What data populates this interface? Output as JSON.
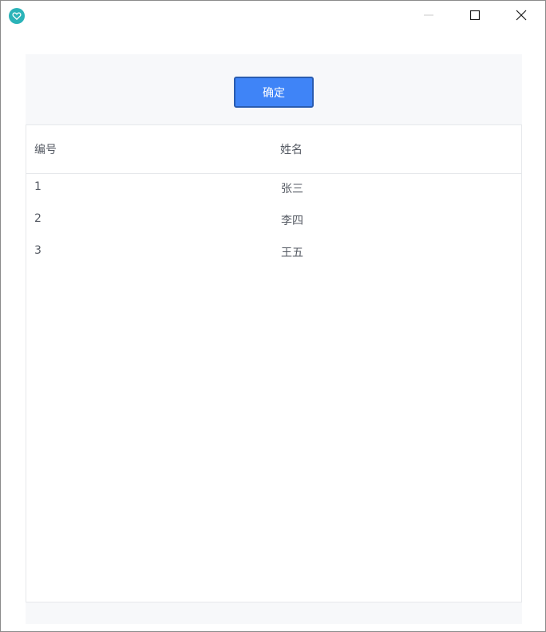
{
  "window": {
    "icon": "heart-icon",
    "controls": [
      "minimize-icon",
      "maximize-icon",
      "close-icon"
    ]
  },
  "toolbar": {
    "confirm_label": "确定"
  },
  "table": {
    "headers": {
      "id": "编号",
      "name": "姓名"
    },
    "rows": [
      {
        "id": "1",
        "name": "张三"
      },
      {
        "id": "2",
        "name": "李四"
      },
      {
        "id": "3",
        "name": "王五"
      }
    ]
  },
  "colors": {
    "accent": "#3f84f7",
    "app_icon": "#2bb3b8"
  }
}
